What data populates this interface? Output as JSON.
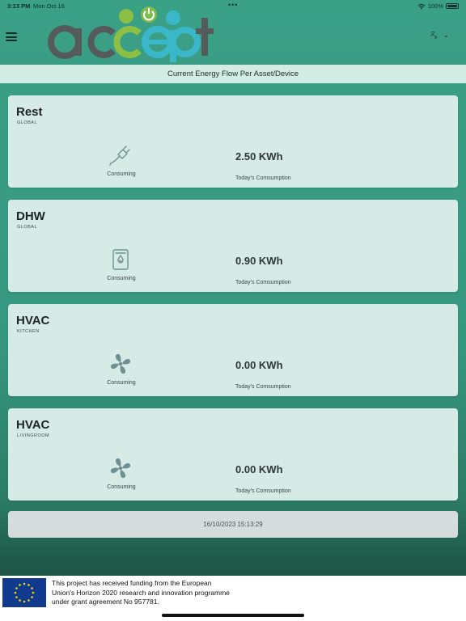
{
  "status_bar": {
    "time": "3:13 PM",
    "date": "Mon Oct 16",
    "dots": "•••",
    "battery": "100%"
  },
  "header": {
    "logo_text": "accept",
    "menu_icon": "hamburger-menu-icon",
    "lang_icon": "translate-icon"
  },
  "page_title": "Current Energy Flow Per Asset/Device",
  "cards": [
    {
      "name": "Rest",
      "location": "GLOBAL",
      "icon": "plug-icon",
      "state": "Consuming",
      "value": "2.50 KWh",
      "value_label": "Today's Comsumption"
    },
    {
      "name": "DHW",
      "location": "GLOBAL",
      "icon": "water-heater-icon",
      "state": "Consuming",
      "value": "0.90 KWh",
      "value_label": "Today's Comsumption"
    },
    {
      "name": "HVAC",
      "location": "KITCHEN",
      "icon": "fan-icon",
      "state": "Consuming",
      "value": "0.00 KWh",
      "value_label": "Today's Comsumption"
    },
    {
      "name": "HVAC",
      "location": "LIVINGROOM",
      "icon": "fan-icon",
      "state": "Consuming",
      "value": "0.00 KWh",
      "value_label": "Today's Comsumption"
    }
  ],
  "timestamp": "16/10/2023 15:13:29",
  "footer": {
    "funding_line1": "This project has received funding from the European",
    "funding_line2": "Union's Horizon 2020 research and innovation programme",
    "funding_line3": "under grant agreement No 957781."
  },
  "colors": {
    "accent": "#3aa086",
    "card": "#d6ebe5",
    "title_bar": "#d3ece4",
    "icon": "#6f8f92"
  }
}
